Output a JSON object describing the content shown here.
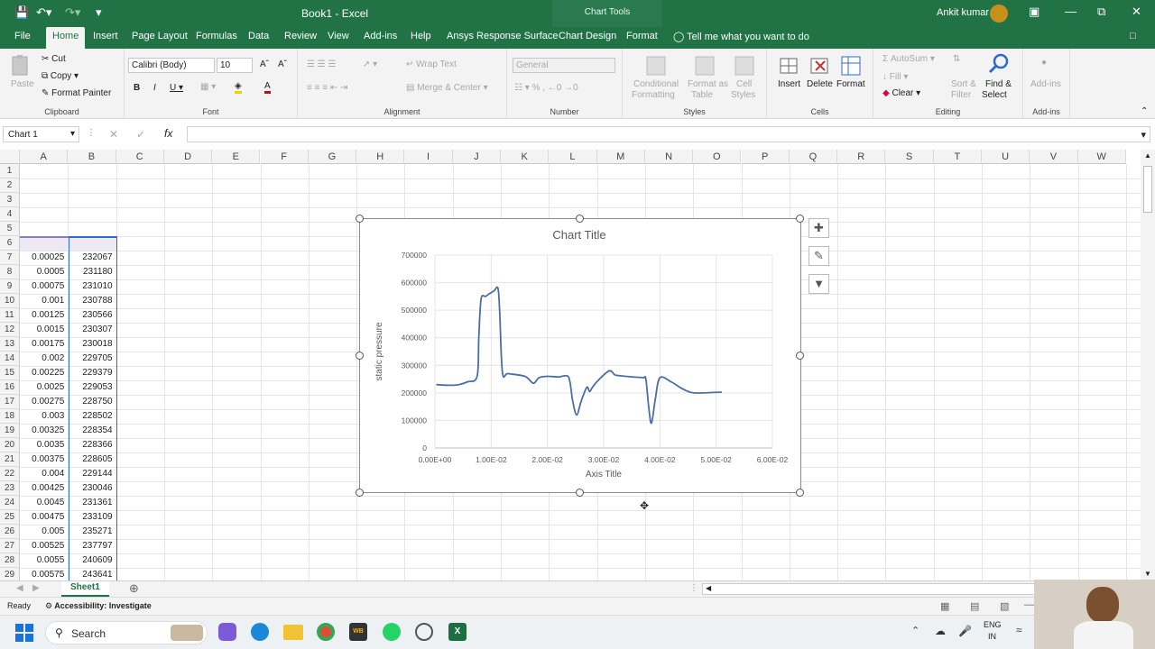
{
  "titlebar": {
    "title": "Book1  -  Excel",
    "chart_tools": "Chart Tools",
    "user": "Ankit kumar"
  },
  "tabs": [
    "File",
    "Home",
    "Insert",
    "Page Layout",
    "Formulas",
    "Data",
    "Review",
    "View",
    "Add-ins",
    "Help",
    "Ansys Response Surface",
    "Chart Design",
    "Format"
  ],
  "tellme": "Tell me what you want to do",
  "ribbon": {
    "clipboard": {
      "paste": "Paste",
      "cut": "Cut",
      "copy": "Copy",
      "format_painter": "Format Painter",
      "label": "Clipboard"
    },
    "font": {
      "name": "Calibri (Body)",
      "size": "10",
      "label": "Font"
    },
    "alignment": {
      "wrap": "Wrap Text",
      "merge": "Merge & Center",
      "label": "Alignment"
    },
    "number": {
      "format": "General",
      "label": "Number"
    },
    "styles": {
      "conditional": "Conditional",
      "conditional2": "Formatting",
      "format_as": "Format as",
      "format_as2": "Table",
      "cell": "Cell",
      "cell2": "Styles",
      "label": "Styles"
    },
    "cells": {
      "insert": "Insert",
      "delete": "Delete",
      "format": "Format",
      "label": "Cells"
    },
    "editing": {
      "autosum": "AutoSum",
      "fill": "Fill",
      "clear": "Clear",
      "sort": "Sort &",
      "sort2": "Filter",
      "find": "Find &",
      "find2": "Select",
      "label": "Editing"
    },
    "addins": {
      "btn": "Add-ins",
      "label": "Add-ins"
    }
  },
  "formula_bar": {
    "name_box": "Chart 1",
    "fx": "fx"
  },
  "columns": [
    "A",
    "B",
    "C",
    "D",
    "E",
    "F",
    "G",
    "H",
    "I",
    "J",
    "K",
    "L",
    "M",
    "N",
    "O",
    "P",
    "Q",
    "R",
    "S",
    "T",
    "U",
    "V",
    "W"
  ],
  "rows": [
    {
      "n": "1",
      "a": "",
      "b": ""
    },
    {
      "n": "2",
      "a": "",
      "b": ""
    },
    {
      "n": "3",
      "a": "",
      "b": ""
    },
    {
      "n": "4",
      "a": "",
      "b": ""
    },
    {
      "n": "5",
      "a": "",
      "b": ""
    },
    {
      "n": "6",
      "a": "",
      "b": ""
    },
    {
      "n": "7",
      "a": "0.00025",
      "b": "232067"
    },
    {
      "n": "8",
      "a": "0.0005",
      "b": "231180"
    },
    {
      "n": "9",
      "a": "0.00075",
      "b": "231010"
    },
    {
      "n": "10",
      "a": "0.001",
      "b": "230788"
    },
    {
      "n": "11",
      "a": "0.00125",
      "b": "230566"
    },
    {
      "n": "12",
      "a": "0.0015",
      "b": "230307"
    },
    {
      "n": "13",
      "a": "0.00175",
      "b": "230018"
    },
    {
      "n": "14",
      "a": "0.002",
      "b": "229705"
    },
    {
      "n": "15",
      "a": "0.00225",
      "b": "229379"
    },
    {
      "n": "16",
      "a": "0.0025",
      "b": "229053"
    },
    {
      "n": "17",
      "a": "0.00275",
      "b": "228750"
    },
    {
      "n": "18",
      "a": "0.003",
      "b": "228502"
    },
    {
      "n": "19",
      "a": "0.00325",
      "b": "228354"
    },
    {
      "n": "20",
      "a": "0.0035",
      "b": "228366"
    },
    {
      "n": "21",
      "a": "0.00375",
      "b": "228605"
    },
    {
      "n": "22",
      "a": "0.004",
      "b": "229144"
    },
    {
      "n": "23",
      "a": "0.00425",
      "b": "230046"
    },
    {
      "n": "24",
      "a": "0.0045",
      "b": "231361"
    },
    {
      "n": "25",
      "a": "0.00475",
      "b": "233109"
    },
    {
      "n": "26",
      "a": "0.005",
      "b": "235271"
    },
    {
      "n": "27",
      "a": "0.00525",
      "b": "237797"
    },
    {
      "n": "28",
      "a": "0.0055",
      "b": "240609"
    },
    {
      "n": "29",
      "a": "0.00575",
      "b": "243641"
    }
  ],
  "sheet_tab": "Sheet1",
  "status": {
    "ready": "Ready",
    "accessibility": "Accessibility: Investigate"
  },
  "taskbar": {
    "search": "Search",
    "lang1": "ENG",
    "lang2": "IN"
  },
  "chart_data": {
    "type": "line",
    "title": "Chart Title",
    "xlabel": "Axis Title",
    "ylabel": "static pressure",
    "xlim": [
      0,
      0.06
    ],
    "ylim": [
      0,
      700000
    ],
    "x_ticks": [
      "0.00E+00",
      "1.00E-02",
      "2.00E-02",
      "3.00E-02",
      "4.00E-02",
      "5.00E-02",
      "6.00E-02"
    ],
    "y_ticks": [
      "0",
      "100000",
      "200000",
      "300000",
      "400000",
      "500000",
      "600000",
      "700000"
    ],
    "grid": true,
    "series": [
      {
        "color": "#4a6fa5",
        "x": [
          0.00025,
          0.002,
          0.004,
          0.0058,
          0.0075,
          0.0078,
          0.0082,
          0.009,
          0.0097,
          0.0105,
          0.0112,
          0.0115,
          0.012,
          0.013,
          0.016,
          0.0175,
          0.0185,
          0.02,
          0.022,
          0.0235,
          0.024,
          0.0245,
          0.0252,
          0.026,
          0.027,
          0.0275,
          0.028,
          0.029,
          0.031,
          0.032,
          0.033,
          0.035,
          0.037,
          0.0375,
          0.038,
          0.0385,
          0.0392,
          0.04,
          0.042,
          0.044,
          0.046,
          0.05,
          0.051
        ],
        "y": [
          230000,
          228000,
          229000,
          240000,
          260000,
          400000,
          540000,
          550000,
          560000,
          570000,
          580000,
          500000,
          275000,
          270000,
          260000,
          235000,
          255000,
          260000,
          258000,
          262000,
          240000,
          170000,
          120000,
          170000,
          220000,
          205000,
          220000,
          245000,
          280000,
          265000,
          262000,
          258000,
          255000,
          250000,
          150000,
          90000,
          180000,
          255000,
          240000,
          215000,
          200000,
          202000,
          203000
        ]
      }
    ]
  }
}
